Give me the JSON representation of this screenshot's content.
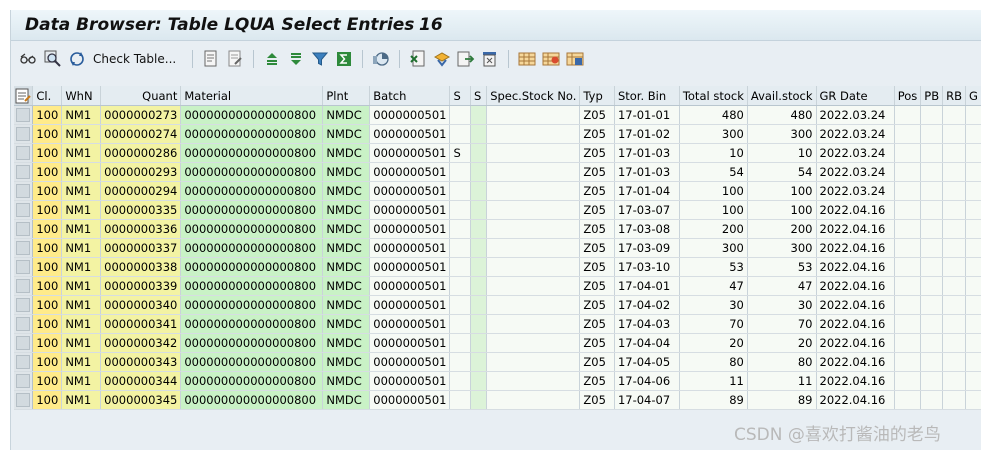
{
  "window": {
    "title": "Data Browser: Table LQUA Select Entries",
    "entry_count": "16"
  },
  "toolbar": {
    "check_table_label": "Check Table...",
    "icons_left": [
      "glasses-icon",
      "magnify-icon",
      "refresh-icon"
    ],
    "icons_right": [
      "details-icon",
      "edit-icon",
      "sort-ascending-icon",
      "sort-descending-icon",
      "filter-icon",
      "sum-icon",
      "graphic-icon",
      "excel-icon",
      "export-icon",
      "send-icon",
      "print-icon",
      "layout-icon",
      "change-layout-icon",
      "save-layout-icon"
    ]
  },
  "table": {
    "columns": [
      "Cl.",
      "WhN",
      "Quant",
      "Material",
      "Plnt",
      "Batch",
      "S",
      "S",
      "Spec.Stock No.",
      "Typ",
      "Stor. Bin",
      "Total stock",
      "Avail.stock",
      "GR Date",
      "Pos",
      "PB",
      "RB",
      "G"
    ],
    "rows": [
      [
        "100",
        "NM1",
        "0000000273",
        "000000000000000800",
        "NMDC",
        "0000000501",
        "",
        "",
        "",
        "Z05",
        "17-01-01",
        "480",
        "480",
        "2022.03.24",
        "",
        "",
        "",
        ""
      ],
      [
        "100",
        "NM1",
        "0000000274",
        "000000000000000800",
        "NMDC",
        "0000000501",
        "",
        "",
        "",
        "Z05",
        "17-01-02",
        "300",
        "300",
        "2022.03.24",
        "",
        "",
        "",
        ""
      ],
      [
        "100",
        "NM1",
        "0000000286",
        "000000000000000800",
        "NMDC",
        "0000000501",
        "S",
        "",
        "",
        "Z05",
        "17-01-03",
        "10",
        "10",
        "2022.03.24",
        "",
        "",
        "",
        ""
      ],
      [
        "100",
        "NM1",
        "0000000293",
        "000000000000000800",
        "NMDC",
        "0000000501",
        "",
        "",
        "",
        "Z05",
        "17-01-03",
        "54",
        "54",
        "2022.03.24",
        "",
        "",
        "",
        ""
      ],
      [
        "100",
        "NM1",
        "0000000294",
        "000000000000000800",
        "NMDC",
        "0000000501",
        "",
        "",
        "",
        "Z05",
        "17-01-04",
        "100",
        "100",
        "2022.03.24",
        "",
        "",
        "",
        ""
      ],
      [
        "100",
        "NM1",
        "0000000335",
        "000000000000000800",
        "NMDC",
        "0000000501",
        "",
        "",
        "",
        "Z05",
        "17-03-07",
        "100",
        "100",
        "2022.04.16",
        "",
        "",
        "",
        ""
      ],
      [
        "100",
        "NM1",
        "0000000336",
        "000000000000000800",
        "NMDC",
        "0000000501",
        "",
        "",
        "",
        "Z05",
        "17-03-08",
        "200",
        "200",
        "2022.04.16",
        "",
        "",
        "",
        ""
      ],
      [
        "100",
        "NM1",
        "0000000337",
        "000000000000000800",
        "NMDC",
        "0000000501",
        "",
        "",
        "",
        "Z05",
        "17-03-09",
        "300",
        "300",
        "2022.04.16",
        "",
        "",
        "",
        ""
      ],
      [
        "100",
        "NM1",
        "0000000338",
        "000000000000000800",
        "NMDC",
        "0000000501",
        "",
        "",
        "",
        "Z05",
        "17-03-10",
        "53",
        "53",
        "2022.04.16",
        "",
        "",
        "",
        ""
      ],
      [
        "100",
        "NM1",
        "0000000339",
        "000000000000000800",
        "NMDC",
        "0000000501",
        "",
        "",
        "",
        "Z05",
        "17-04-01",
        "47",
        "47",
        "2022.04.16",
        "",
        "",
        "",
        ""
      ],
      [
        "100",
        "NM1",
        "0000000340",
        "000000000000000800",
        "NMDC",
        "0000000501",
        "",
        "",
        "",
        "Z05",
        "17-04-02",
        "30",
        "30",
        "2022.04.16",
        "",
        "",
        "",
        ""
      ],
      [
        "100",
        "NM1",
        "0000000341",
        "000000000000000800",
        "NMDC",
        "0000000501",
        "",
        "",
        "",
        "Z05",
        "17-04-03",
        "70",
        "70",
        "2022.04.16",
        "",
        "",
        "",
        ""
      ],
      [
        "100",
        "NM1",
        "0000000342",
        "000000000000000800",
        "NMDC",
        "0000000501",
        "",
        "",
        "",
        "Z05",
        "17-04-04",
        "20",
        "20",
        "2022.04.16",
        "",
        "",
        "",
        ""
      ],
      [
        "100",
        "NM1",
        "0000000343",
        "000000000000000800",
        "NMDC",
        "0000000501",
        "",
        "",
        "",
        "Z05",
        "17-04-05",
        "80",
        "80",
        "2022.04.16",
        "",
        "",
        "",
        ""
      ],
      [
        "100",
        "NM1",
        "0000000344",
        "000000000000000800",
        "NMDC",
        "0000000501",
        "",
        "",
        "",
        "Z05",
        "17-04-06",
        "11",
        "11",
        "2022.04.16",
        "",
        "",
        "",
        ""
      ],
      [
        "100",
        "NM1",
        "0000000345",
        "000000000000000800",
        "NMDC",
        "0000000501",
        "",
        "",
        "",
        "Z05",
        "17-04-07",
        "89",
        "89",
        "2022.04.16",
        "",
        "",
        "",
        ""
      ]
    ]
  },
  "watermark": "CSDN @喜欢打酱油的老鸟",
  "colors": {
    "key_client": "#ffeb8a",
    "key_field": "#f3f3a3",
    "data_field": "#c9f2c6",
    "window_bg": "#e8eef3"
  }
}
